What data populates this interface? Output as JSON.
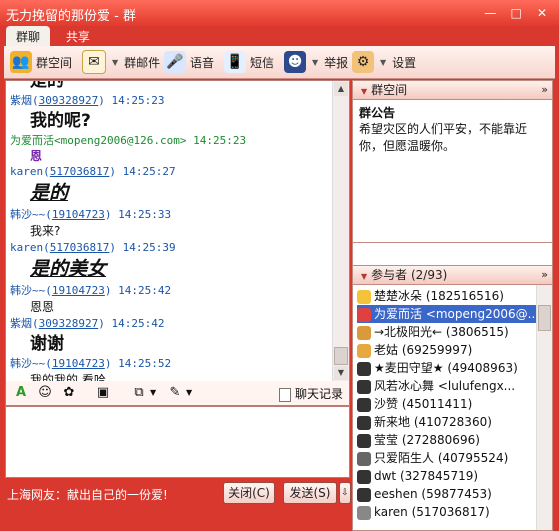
{
  "window": {
    "title": "无力挽留的那份爱 - 群",
    "controls": [
      "—",
      "□",
      "✕"
    ]
  },
  "tabs": [
    "群聊",
    "共享"
  ],
  "toolbar": [
    {
      "label": "群空间",
      "icon": "people-icon"
    },
    {
      "label": "群邮件",
      "icon": "mail-icon"
    },
    {
      "label": "语音",
      "icon": "voice-icon"
    },
    {
      "label": "短信",
      "icon": "sms-icon"
    },
    {
      "label": "举报",
      "icon": "police-icon"
    },
    {
      "label": "设置",
      "icon": "settings-icon"
    }
  ],
  "chat": {
    "top_partial": "是的",
    "messages": [
      {
        "name": "紫烟",
        "uid": "309328927",
        "time": "14:25:23",
        "text": "我的呢?"
      },
      {
        "name": "为爱而活",
        "uid": "mopeng2006@126.com",
        "time": "14:25:23",
        "text": "恩"
      },
      {
        "name": "karen",
        "uid": "517036817",
        "time": "14:25:27",
        "text": "是的"
      },
      {
        "name": "韩沙~~",
        "uid": "19104723",
        "time": "14:25:33",
        "text": "我来?"
      },
      {
        "name": "karen",
        "uid": "517036817",
        "time": "14:25:39",
        "text": "是的美女"
      },
      {
        "name": "韩沙~~",
        "uid": "19104723",
        "time": "14:25:42",
        "text": "恩恩"
      },
      {
        "name": "紫烟",
        "uid": "309328927",
        "time": "14:25:42",
        "text": "谢谢"
      },
      {
        "name": "韩沙~~",
        "uid": "19104723",
        "time": "14:25:52",
        "text": "我的我的 看哈"
      }
    ]
  },
  "format_bar": {
    "history_label": "聊天记录"
  },
  "footer": {
    "ad": "上海网友：献出自己的一份爱!",
    "close_label": "关闭(C)",
    "send_label": "发送(S)"
  },
  "notice_panel": {
    "header": "群空间",
    "title": "群公告",
    "text": "希望灾区的人们平安，不能靠近你，但愿温暖你。"
  },
  "members_panel": {
    "header": "参与者 (2/93)",
    "members": [
      "楚楚冰朵 (182516516)",
      "为爱而活 <mopeng2006@...",
      "→北极阳光← (3806515)",
      "老姑 (69259997)",
      "★麦田守望★ (49408963)",
      "风若冰心舞 <lulufengx...",
      "沙赞 (45011411)",
      "新来地 (410728360)",
      "莹莹 (272880696)",
      "只爱陌生人 (40795524)",
      "dwt (327845719)",
      "eeshen (59877453)",
      "karen (517036817)"
    ]
  }
}
